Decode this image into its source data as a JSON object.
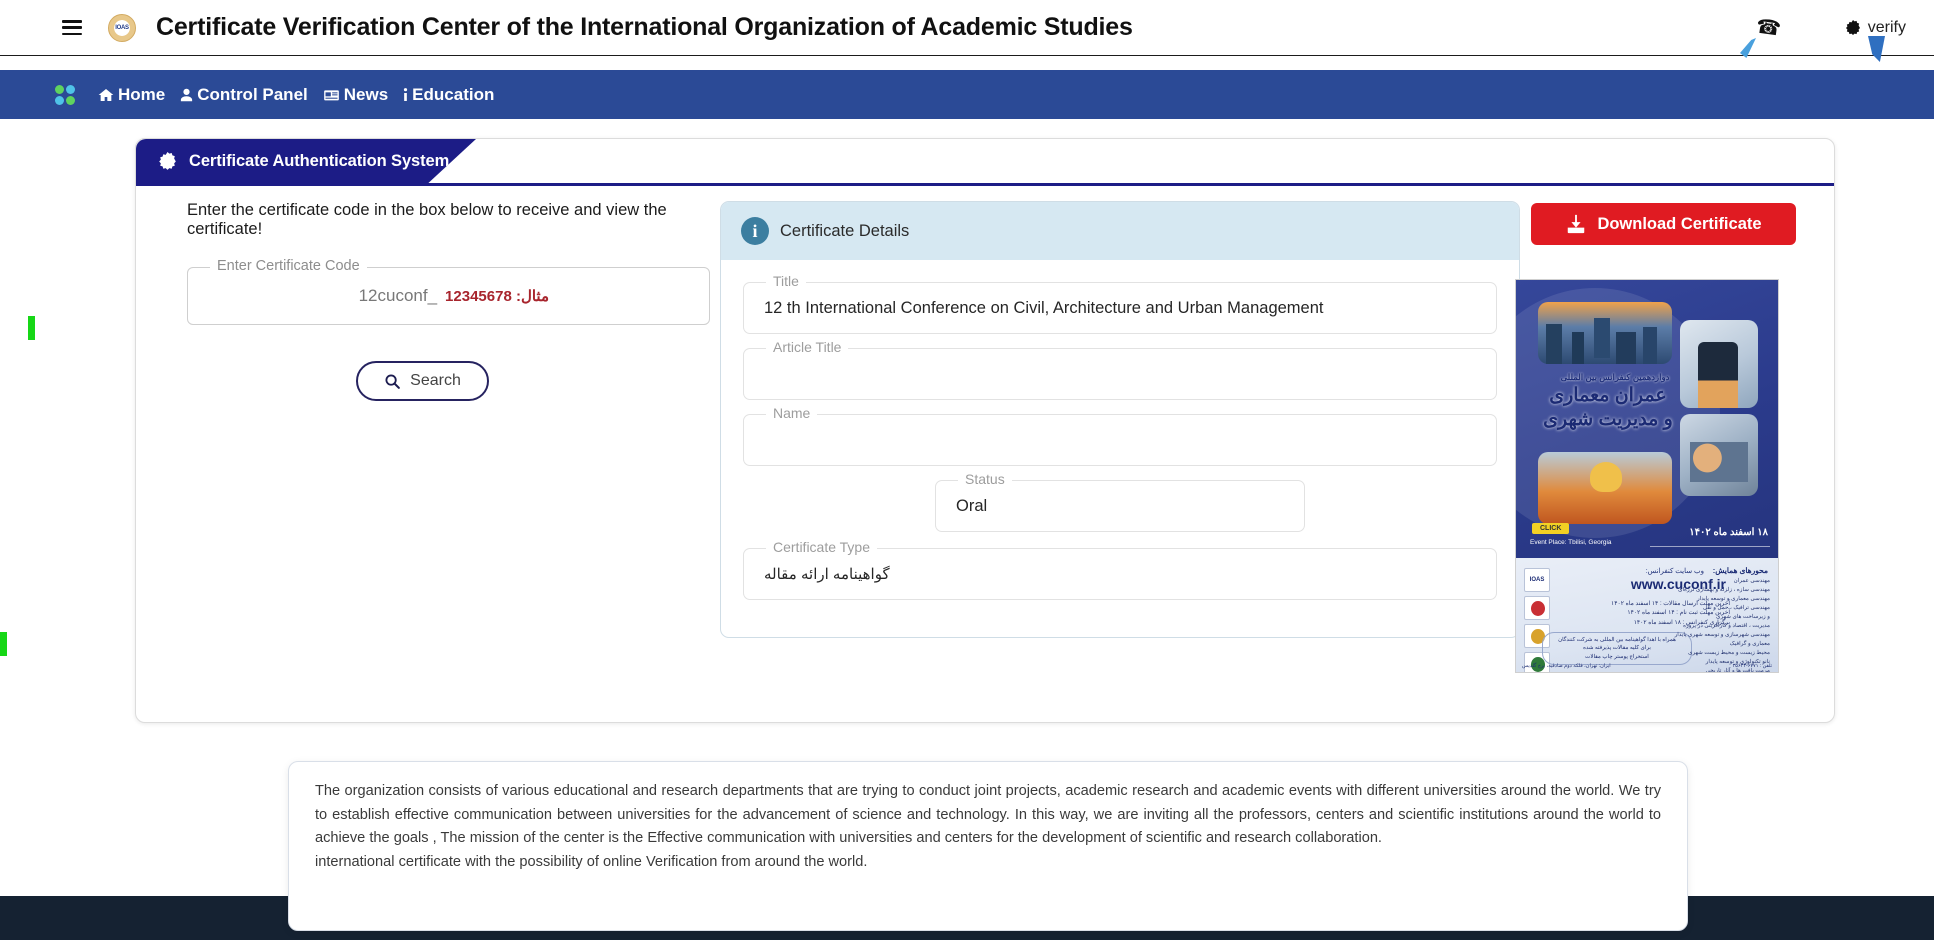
{
  "topbar": {
    "menu_icon": "hamburger-icon",
    "logo_text": "IOAS",
    "title": "Certificate Verification Center of the International Organization of Academic Studies",
    "phone_icon": "phone-icon",
    "verify_icon": "seal-icon",
    "verify_label": "verify"
  },
  "nav": {
    "grid_icon": "grid-dots-icon",
    "items": [
      {
        "label": "Home",
        "icon": "home-icon"
      },
      {
        "label": "Control Panel",
        "icon": "user-icon"
      },
      {
        "label": "News",
        "icon": "newspaper-icon"
      },
      {
        "label": "Education",
        "icon": "info-icon"
      }
    ]
  },
  "card": {
    "tab_icon": "seal-icon",
    "tab_label": "Certificate Authentication System"
  },
  "left": {
    "instruction": "Enter the certificate code in the box below to receive and view the certificate!",
    "code_field_legend": "Enter Certificate Code",
    "code_placeholder": "12cuconf_",
    "code_example": "مثال: 12345678",
    "code_value": "",
    "search_icon": "search-icon",
    "search_label": "Search"
  },
  "details": {
    "header_icon": "info-icon",
    "header_label": "Certificate Details",
    "fields": [
      {
        "legend": "Title",
        "value": "12 th International Conference on Civil, Architecture and Urban Management",
        "rtl": false
      },
      {
        "legend": "Article Title",
        "value": "",
        "rtl": false
      },
      {
        "legend": "Name",
        "value": "",
        "rtl": false
      },
      {
        "legend": "Status",
        "value": "Oral",
        "rtl": false
      },
      {
        "legend": "Certificate Type",
        "value": "گواهینامه ارائه مقاله",
        "rtl": true
      }
    ]
  },
  "right": {
    "download_icon": "download-icon",
    "download_label": "Download Certificate"
  },
  "poster": {
    "subtitle": "دوازدهمین کنفرانس بین المللی",
    "title_line1": "عمران معماری",
    "title_line2": "و مدیریت شهری",
    "date": "۱۸ اسفند ماه ۱۴۰۲",
    "click_badge": "CLICK",
    "place": "Event Place: Tbilisi, Georgia",
    "website_label": "وب سایت کنفرانس:",
    "website": "www.cuconf.ir",
    "deadlines": "آخرین مهلت ارسال مقالات : ۱۴ اسفند ماه ۱۴۰۲\nآخرین مهلت ثبت نام : ۱۴ اسفند ماه ۱۴۰۲\nبرگزاری کنفرانس : ۱۸ اسفند ماه ۱۴۰۲",
    "note": "همراه با اهدا گواهینامه بین المللی به شرکت کنندگان\nبرای کلیه مقالات پذیرفته شده\nاستخراج پوستر چاپ مقالات",
    "axes_header": "محورهای همایش:",
    "axes": "مهندسی عمران\nمهندسی سازه ، زلزله و بهسازی لرزه‌ای\nمهندسی معماری و توسعه پایدار\nمهندسی ترافیک ، حمل و نقل\nو زیرساخت های شهری\nمدیریت ، اقتصاد و کارآفرینی در پروژه\nمهندسی شهرسازی و توسعه شهری پایدار\nمعماری و گرافیک\nمحیط زیست و محیط زیست شهری\nنانو تکنولوژی و توسعه پایدار\nمرمت بافت ها و آثار تاریخی\nمهندسی مکانیک و تاسیسات\nو سایر محورهای مرتبط",
    "contact_left": "تلفن : ۶۷۷۱-۳۵۶۳۳",
    "contact_right": "ایران: تهران، فلکه دوم صادقیه، برج گلدیس"
  },
  "footer": {
    "paragraph1": "The organization consists of various educational and research departments that are trying to conduct joint projects, academic research and academic events with different universities around the world. We try to establish effective communication between universities for the advancement of science and technology. In this way, we are inviting all the professors, centers and scientific institutions around the world to achieve the goals , The mission of the center is the Effective communication with universities and centers for the development of scientific and research collaboration.",
    "paragraph2": "international certificate with the possibility of online Verification from around the world."
  },
  "colors": {
    "nav_blue": "#2b4a96",
    "tab_navy": "#1c1c86",
    "download_red": "#e01b22",
    "details_header": "#d6e8f2",
    "footer_dark": "#152232",
    "example_red": "#a8252d",
    "marker_green": "#16d716"
  }
}
